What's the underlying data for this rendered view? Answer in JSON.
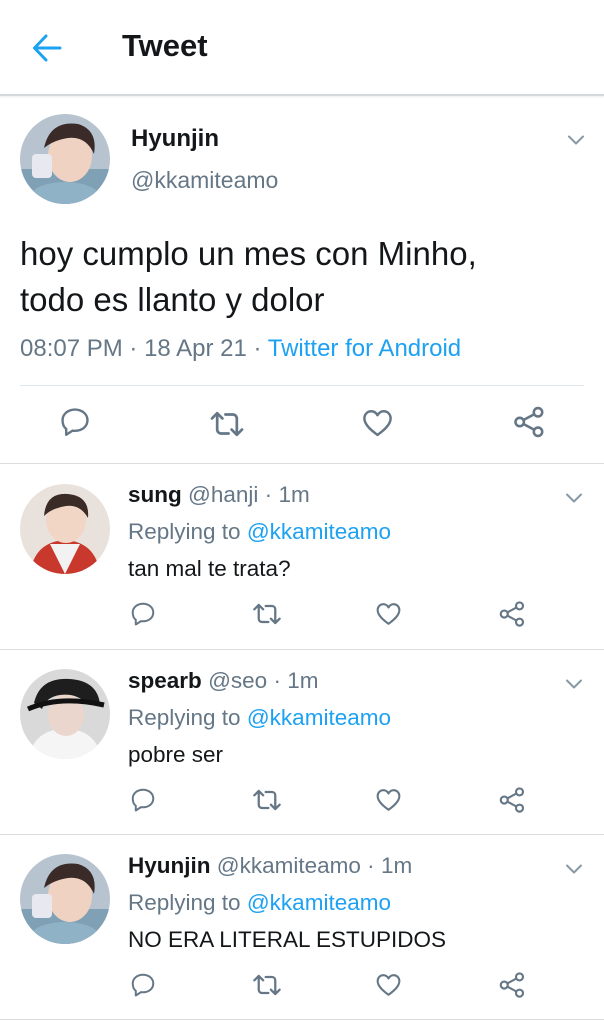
{
  "header": {
    "title": "Tweet"
  },
  "main_tweet": {
    "name": "Hyunjin",
    "handle": "@kkamiteamo",
    "text_line1": "hoy cumplo un mes con Minho,",
    "text_line2": "todo es llanto y dolor",
    "time": "08:07 PM",
    "date": "18 Apr 21",
    "dot": "·",
    "source": "Twitter for Android"
  },
  "replies": [
    {
      "name": "sung",
      "handle": "@hanji",
      "time_sep": "·",
      "time": "1m",
      "replying_label": "Replying to",
      "replying_to": "@kkamiteamo",
      "text": "tan mal te trata?"
    },
    {
      "name": "spearb",
      "handle": "@seo",
      "time_sep": "·",
      "time": "1m",
      "replying_label": "Replying to",
      "replying_to": "@kkamiteamo",
      "text": "pobre ser"
    },
    {
      "name": "Hyunjin",
      "handle": "@kkamiteamo",
      "time_sep": "·",
      "time": "1m",
      "replying_label": "Replying to",
      "replying_to": "@kkamiteamo",
      "text": "NO ERA LITERAL ESTUPIDOS"
    }
  ],
  "icons": {
    "back": "arrow-left-icon",
    "caret": "chevron-down-icon",
    "reply": "comment-icon",
    "retweet": "retweet-icon",
    "like": "heart-icon",
    "share": "share-icon"
  },
  "colors": {
    "accent": "#1da1f2",
    "muted": "#657786",
    "text": "#14171a"
  }
}
